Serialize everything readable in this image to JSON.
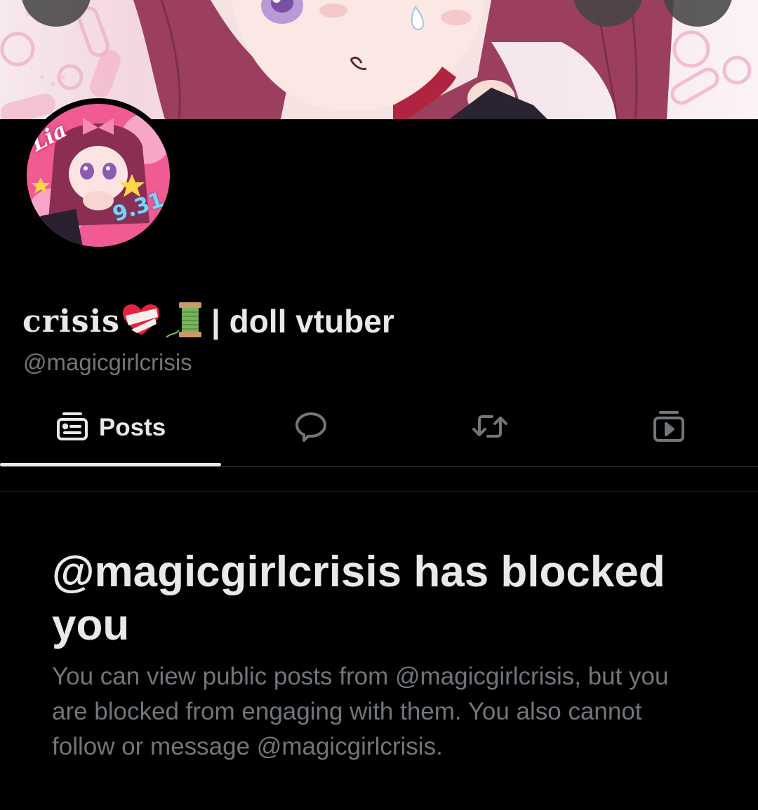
{
  "profile": {
    "display_name_stylized": "crisis",
    "display_name_rest": "| doll vtuber",
    "handle": "@magicgirlcrisis",
    "avatar_text": "Lia",
    "avatar_date": "9.31"
  },
  "tabs": [
    {
      "label": "Posts",
      "icon": "posts-icon",
      "selected": true
    },
    {
      "label": "",
      "icon": "replies-icon"
    },
    {
      "label": "",
      "icon": "reposts-icon"
    },
    {
      "label": "",
      "icon": "media-icon"
    }
  ],
  "blocked": {
    "title": "@magicgirlcrisis has blocked you",
    "description": "You can view public posts from @magicgirlcrisis, but you are blocked from engaging with them. You also cannot follow or message @magicgirlcrisis."
  },
  "colors": {
    "background": "#000000",
    "text_primary": "#e7e9ea",
    "text_secondary": "#71767b",
    "divider": "#2f3336",
    "banner_hair": "#9c3f5e"
  }
}
